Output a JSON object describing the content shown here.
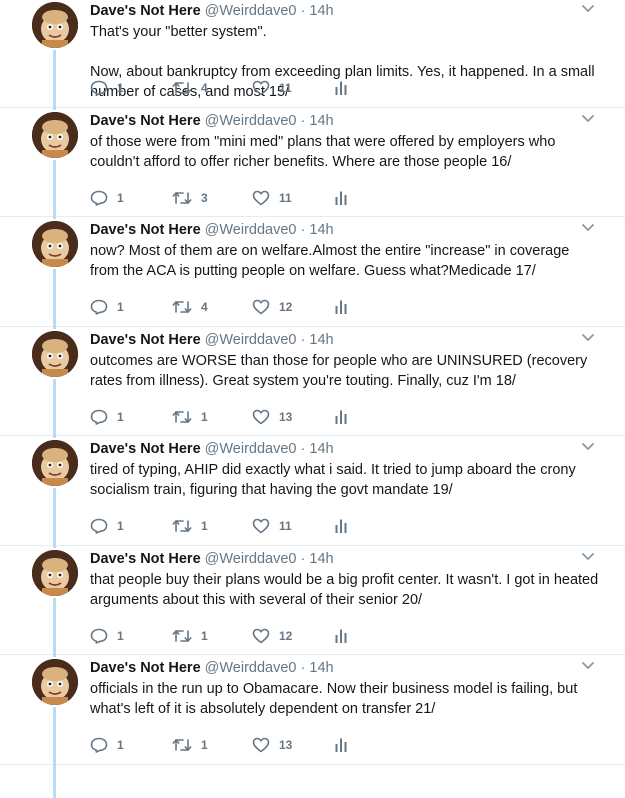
{
  "tweets": [
    {
      "name": "Dave's Not Here",
      "handle": "@Weirddave0",
      "separator": "·",
      "time": "14h",
      "text": "That's your \"better system\".\n\nNow, about bankruptcy from exceeding plan limits. Yes, it happened. In a small number of cases, and most 15/",
      "replies": "1",
      "retweets": "4",
      "likes": "11"
    },
    {
      "name": "Dave's Not Here",
      "handle": "@Weirddave0",
      "separator": "·",
      "time": "14h",
      "text": "of those were from \"mini med\" plans that were offered by employers who couldn't afford to offer richer benefits. Where are those people 16/",
      "replies": "1",
      "retweets": "3",
      "likes": "11"
    },
    {
      "name": "Dave's Not Here",
      "handle": "@Weirddave0",
      "separator": "·",
      "time": "14h",
      "text": "now? Most of them are on welfare.Almost the entire \"increase\" in coverage from the ACA is putting people on welfare. Guess what?Medicade 17/",
      "replies": "1",
      "retweets": "4",
      "likes": "12"
    },
    {
      "name": "Dave's Not Here",
      "handle": "@Weirddave0",
      "separator": "·",
      "time": "14h",
      "text": "outcomes are WORSE than those for people who are UNINSURED (recovery rates from illness). Great system you're touting. Finally, cuz I'm 18/",
      "replies": "1",
      "retweets": "1",
      "likes": "13"
    },
    {
      "name": "Dave's Not Here",
      "handle": "@Weirddave0",
      "separator": "·",
      "time": "14h",
      "text": "tired of typing, AHIP did exactly what i said. It tried to jump aboard the crony socialism train, figuring that having the govt mandate 19/",
      "replies": "1",
      "retweets": "1",
      "likes": "11"
    },
    {
      "name": "Dave's Not Here",
      "handle": "@Weirddave0",
      "separator": "·",
      "time": "14h",
      "text": "that people buy their plans would be a big profit center. It wasn't. I got in heated arguments about this with several of their senior 20/",
      "replies": "1",
      "retweets": "1",
      "likes": "12"
    },
    {
      "name": "Dave's Not Here",
      "handle": "@Weirddave0",
      "separator": "·",
      "time": "14h",
      "text": "officials in the run up to Obamacare. Now their business model is failing, but what's left of it is absolutely dependent on transfer 21/",
      "replies": "1",
      "retweets": "1",
      "likes": "13"
    }
  ],
  "icons": {
    "reply": "reply-icon",
    "retweet": "retweet-icon",
    "like": "heart-icon",
    "stats": "analytics-icon",
    "menu": "chevron-down-icon",
    "avatar": "avatar"
  },
  "colors": {
    "thread_line": "#b8dcf5",
    "secondary_text": "#657786",
    "primary_text": "#14171a"
  }
}
